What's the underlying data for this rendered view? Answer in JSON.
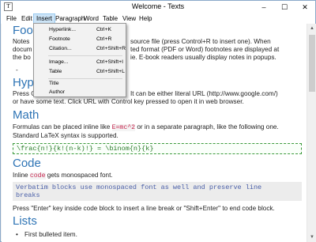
{
  "window": {
    "title": "Welcome - Texts",
    "icon": "T",
    "minimize": "–",
    "maximize": "☐",
    "close": "✕"
  },
  "menubar": {
    "items": [
      "File",
      "Edit",
      "Insert",
      "Paragraph",
      "Word",
      "Table",
      "View",
      "Help"
    ],
    "active": "Insert"
  },
  "insert_menu": {
    "items": [
      {
        "label": "Hyperlink...",
        "shortcut": "Ctrl+K"
      },
      {
        "label": "Footnote",
        "shortcut": "Ctrl+R"
      },
      {
        "label": "Citation...",
        "shortcut": "Ctrl+Shift+R"
      },
      {
        "label": "Image...",
        "shortcut": "Ctrl+Shift+I"
      },
      {
        "label": "Table",
        "shortcut": "Ctrl+Shift+L"
      },
      {
        "label": "Title",
        "shortcut": ""
      },
      {
        "label": "Author",
        "shortcut": ""
      }
    ]
  },
  "document": {
    "footnotes_heading_visible": "Foot",
    "footnotes_line1_prefix": "Notes",
    "footnotes_line1": "source file (press Control+R to insert one). When",
    "footnotes_line2_prefix": "docum",
    "footnotes_line2": "ted format (PDF or Word) footnotes are displayed at",
    "footnotes_line3_prefix": "the bo",
    "footnotes_line3": "ie. E-book readers usually display notes in popups.",
    "footnote_marker": "-",
    "hyperlinks_heading_visible": "Hype",
    "hyperlinks_line1_prefix": "Press C",
    "hyperlinks_line1": "It can be either literal URL (http://www.google.com/)",
    "hyperlinks_line2": "or have some text. Click URL with Control key pressed to open it in web browser.",
    "math_heading": "Math",
    "math_line1_a": "Formulas can be placed inline like ",
    "math_inline_code": "E=mc^2",
    "math_line1_b": " or in a separate paragraph, like the following one.",
    "math_line2": "Standard LaTeX syntax is supported.",
    "latex_block": "\\frac{n!}{k!(n-k)!} = \\binom{n}{k}",
    "code_heading": "Code",
    "code_line1_a": "Inline ",
    "code_inline": "code",
    "code_line1_b": " gets monospaced font.",
    "verbatim_line1": "Verbatim blocks use monospaced font as well and preserve line",
    "verbatim_line2": "breaks",
    "code_line2": "Press \"Enter\" key inside code block to insert a line break or \"Shift+Enter\" to end code block.",
    "lists_heading": "Lists",
    "list_item1": "First bulleted item."
  }
}
